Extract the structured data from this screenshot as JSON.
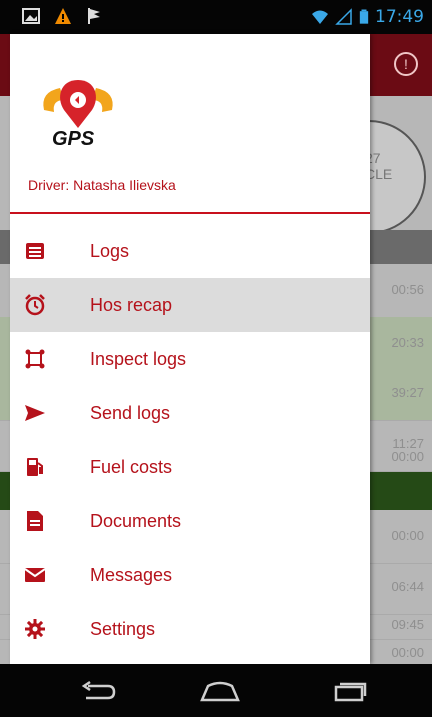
{
  "status_bar": {
    "time": "17:49",
    "icons_left": [
      "gallery-icon",
      "warning-icon",
      "flag-icon"
    ],
    "icons_right": [
      "wifi-icon",
      "signal-icon",
      "battery-icon"
    ]
  },
  "background": {
    "circle_text": "27\nCLE",
    "row_times": [
      "00:56",
      "20:33",
      "39:27",
      "11:27",
      "00:00",
      "00:00",
      "06:44",
      "09:45",
      "00:00"
    ]
  },
  "drawer": {
    "logo_text": "GPS",
    "driver_label": "Driver: Natasha Ilievska",
    "menu": [
      {
        "label": "Logs",
        "icon": "list-icon"
      },
      {
        "label": "Hos recap",
        "icon": "alarm-clock-icon"
      },
      {
        "label": "Inspect logs",
        "icon": "inspect-icon"
      },
      {
        "label": "Send logs",
        "icon": "send-icon"
      },
      {
        "label": "Fuel costs",
        "icon": "fuel-pump-icon"
      },
      {
        "label": "Documents",
        "icon": "document-icon"
      },
      {
        "label": "Messages",
        "icon": "envelope-icon"
      },
      {
        "label": "Settings",
        "icon": "gear-icon"
      }
    ]
  },
  "colors": {
    "accent": "#b5121b",
    "header_bg": "#6b0b14",
    "green_band": "#254a16"
  }
}
